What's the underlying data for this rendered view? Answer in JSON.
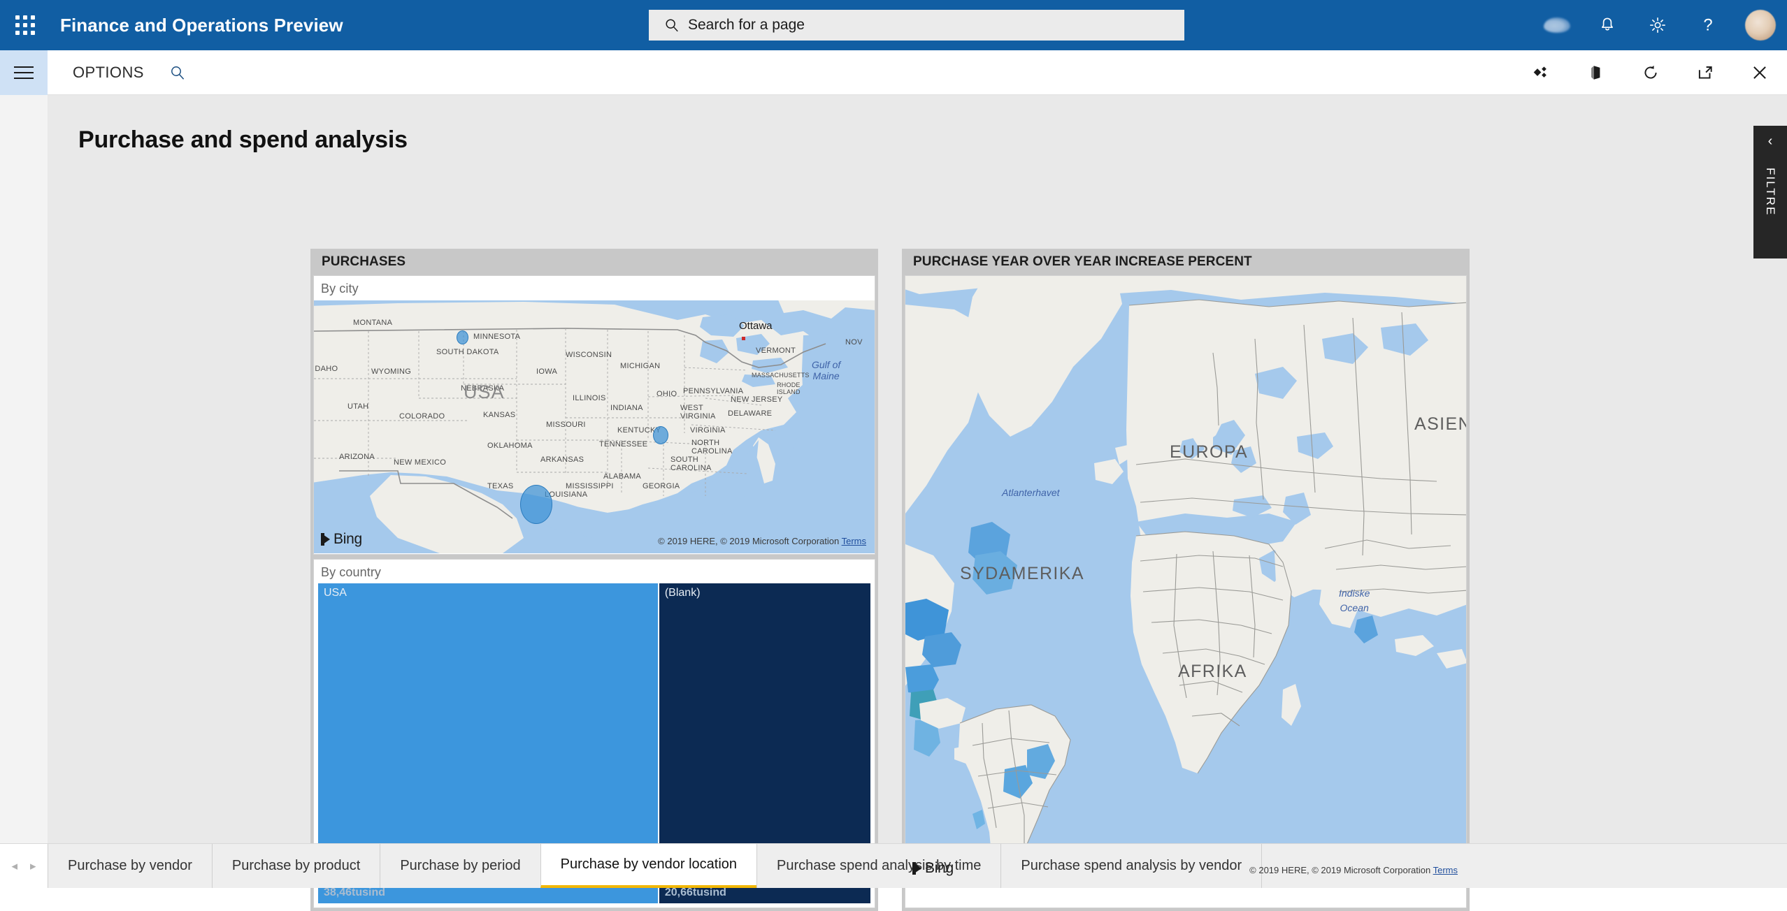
{
  "topbar": {
    "waffle_icon": "app-launcher-icon",
    "app_title": "Finance and Operations Preview",
    "search": {
      "placeholder": "Search for a page",
      "icon": "search-icon"
    },
    "icons": [
      {
        "name": "cloud-icon",
        "label": "Cloud"
      },
      {
        "name": "bell-icon",
        "label": "Notifications"
      },
      {
        "name": "gear-icon",
        "label": "Settings"
      },
      {
        "name": "help-icon",
        "label": "Help",
        "glyph": "?"
      },
      {
        "name": "avatar",
        "label": "User account"
      }
    ]
  },
  "optionsbar": {
    "hamburger_icon": "hamburger-menu-icon",
    "options_label": "OPTIONS",
    "search_icon": "search-icon",
    "right_icons": [
      {
        "name": "personalize-icon",
        "label": "Personalize"
      },
      {
        "name": "office-icon",
        "label": "Open in Microsoft Office"
      },
      {
        "name": "refresh-icon",
        "label": "Refresh"
      },
      {
        "name": "open-in-new-window-icon",
        "label": "Open in new window"
      },
      {
        "name": "close-icon",
        "label": "Close",
        "glyph": "✕"
      }
    ]
  },
  "page": {
    "title": "Purchase and spend analysis"
  },
  "cards": [
    {
      "id": "purchases",
      "header": "PURCHASES",
      "tiles": [
        {
          "id": "by-city",
          "title": "By city"
        },
        {
          "id": "by-country",
          "title": "By country"
        }
      ]
    },
    {
      "id": "yoy",
      "header": "PURCHASE YEAR OVER YEAR INCREASE PERCENT",
      "tiles": [
        {
          "id": "world-map",
          "title": ""
        }
      ]
    }
  ],
  "map_usa": {
    "bing_label": "Bing",
    "attribution": "© 2019 HERE, © 2019 Microsoft Corporation",
    "terms": "Terms",
    "country_label": "USA",
    "city_labels": [
      "Ottawa"
    ],
    "ocean_labels": [
      "Gulf of Maine"
    ],
    "state_labels": [
      "MONTANA",
      "MINNESOTA",
      "SOUTH DAKOTA",
      "WISCONSIN",
      "IDAHO",
      "WYOMING",
      "MICHIGAN",
      "IOWA",
      "NEBRASKA",
      "ILLINOIS",
      "OHIO",
      "PENNSYLVANIA",
      "UTAH",
      "COLORADO",
      "KANSAS",
      "MISSOURI",
      "INDIANA",
      "WEST VIRGINIA",
      "DELAWARE",
      "NEW JERSEY",
      "KENTUCKY",
      "VIRGINIA",
      "OKLAHOMA",
      "TENNESSEE",
      "NORTH CAROLINA",
      "ARIZONA",
      "NEW MEXICO",
      "ARKANSAS",
      "SOUTH CAROLINA",
      "TEXAS",
      "LOUISIANA",
      "MISSISSIPPI",
      "ALABAMA",
      "GEORGIA",
      "VERMONT",
      "MASSACHUSETTS",
      "RHODE ISLAND",
      "NOV"
    ],
    "bubbles": [
      {
        "city": "Minnesota area",
        "size": "small"
      },
      {
        "city": "South Carolina area",
        "size": "medium"
      },
      {
        "city": "Gulf Coast / Texas area",
        "size": "large"
      }
    ]
  },
  "map_world": {
    "bing_label": "Bing",
    "attribution": "© 2019 HERE, © 2019 Microsoft Corporation",
    "terms": "Terms",
    "continent_labels": [
      "EUROPA",
      "ASIEN",
      "AFRIKA",
      "SYDAMERIKA"
    ],
    "ocean_labels": [
      "Atlanterhavet",
      "Indiske Ocean"
    ]
  },
  "chart_data": {
    "type": "treemap",
    "title": "By country",
    "categories": [
      "USA",
      "(Blank)"
    ],
    "value_labels": [
      "38,46tusind",
      "20,66tusind"
    ],
    "values": [
      38460,
      20660
    ],
    "colors": [
      "#3c96dd",
      "#0c2a53"
    ],
    "unit": "tusind",
    "legend": "none"
  },
  "filter_panel": {
    "chevron_icon": "chevron-left-icon",
    "label": "FILTRE"
  },
  "tabbar": {
    "prev_arrow": "◂",
    "next_arrow": "▸",
    "tabs": [
      {
        "label": "Purchase by vendor",
        "active": false
      },
      {
        "label": "Purchase by product",
        "active": false
      },
      {
        "label": "Purchase by period",
        "active": false
      },
      {
        "label": "Purchase by vendor location",
        "active": true
      },
      {
        "label": "Purchase spend analysis by time",
        "active": false
      },
      {
        "label": "Purchase spend analysis by vendor",
        "active": false
      }
    ]
  },
  "colors": {
    "brand_blue": "#115ea3",
    "accent_yellow": "#f2b705",
    "treemap_blue": "#3c96dd",
    "treemap_navy": "#0c2a53",
    "card_header_gray": "#c8c8c8",
    "canvas_gray": "#e9e9e9"
  }
}
